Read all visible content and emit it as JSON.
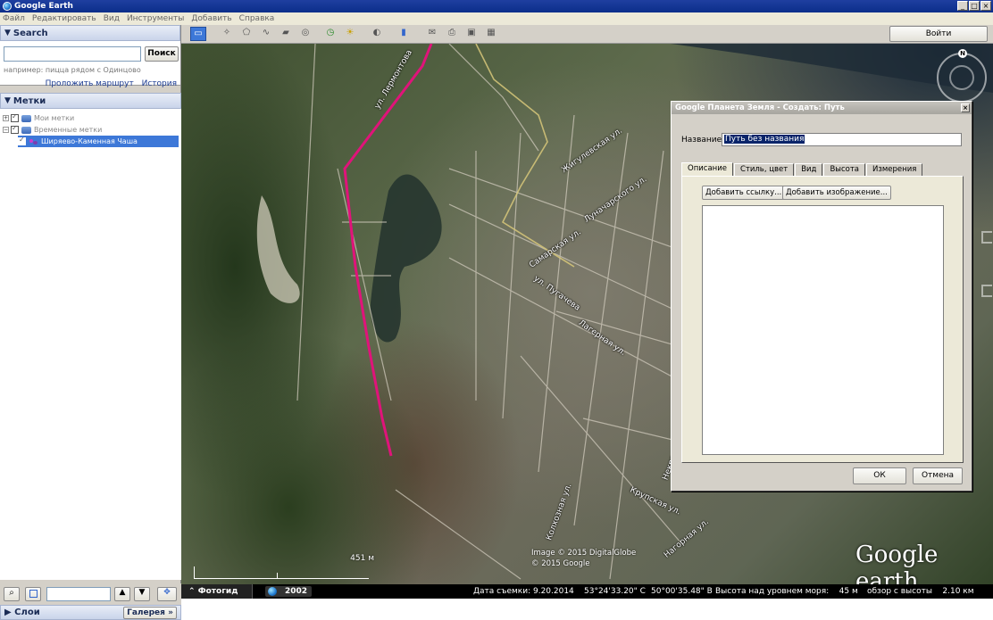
{
  "window": {
    "title": "Google Earth"
  },
  "menu": [
    "Файл",
    "Редактировать",
    "Вид",
    "Инструменты",
    "Добавить",
    "Справка"
  ],
  "search": {
    "header": "Search",
    "input_value": "",
    "button": "Поиск",
    "hint": "например: пицца рядом с Одинцово",
    "links": [
      "Проложить маршрут",
      "История"
    ]
  },
  "places": {
    "header": "Метки",
    "items": [
      {
        "label": "Мои метки"
      },
      {
        "label": "Временные метки"
      },
      {
        "label": "Ширяево-Каменная Чаша"
      }
    ]
  },
  "layers": {
    "label": "Слои",
    "gallery": "Галерея"
  },
  "toolbar": {
    "signin": "Войти"
  },
  "map": {
    "roads": [
      "ул. Лермонтова",
      "Жигулевская ул.",
      "Луначарского ул.",
      "Самарская ул.",
      "ул. Пугачева",
      "Лагерная ул.",
      "Некрасовская ул.",
      "Крупская ул.",
      "Колхозная ул.",
      "Нагорная ул."
    ],
    "scale": "451 м",
    "copyright": [
      "Image © 2015 DigitalGlobe",
      "© 2015 Google"
    ],
    "logo": "Google earth",
    "compass_n": "N"
  },
  "status": {
    "tour": "Фотогид",
    "year": "2002",
    "date": "Дата съемки: 9.20.2014",
    "lat": "53°24'33.20\" С",
    "lon": "50°00'35.48\" В",
    "elev": "Высота над уровнем моря:    45 м",
    "eye": "обзор с высоты    2.10 км"
  },
  "dialog": {
    "title": "Google Планета Земля - Создать: Путь",
    "name_label": "Название:",
    "name_value": "Путь без названия",
    "tabs": [
      "Описание",
      "Стиль, цвет",
      "Вид",
      "Высота",
      "Измерения"
    ],
    "add_link": "Добавить ссылку...",
    "add_image": "Добавить изображение...",
    "ok": "ОК",
    "cancel": "Отмена"
  }
}
